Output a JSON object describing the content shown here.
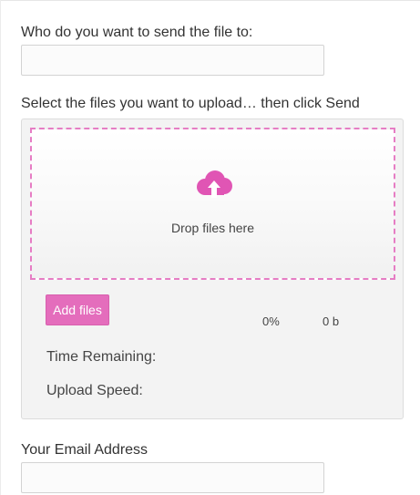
{
  "recipient": {
    "label": "Who do you want to send the file to:",
    "value": "",
    "placeholder": ""
  },
  "upload": {
    "instruction": "Select the files you want to upload… then click Send",
    "dropzone_icon": "cloud-upload-icon",
    "dropzone_text": "Drop files here",
    "add_files_label": "Add files",
    "progress_percent": "0%",
    "transferred_size": "0 b",
    "time_remaining_label": "Time Remaining:",
    "upload_speed_label": "Upload Speed:"
  },
  "sender": {
    "label": "Your Email Address",
    "value": "",
    "placeholder": ""
  },
  "colors": {
    "accent": "#e46dbc",
    "dropzone_border": "#e67dc4"
  }
}
